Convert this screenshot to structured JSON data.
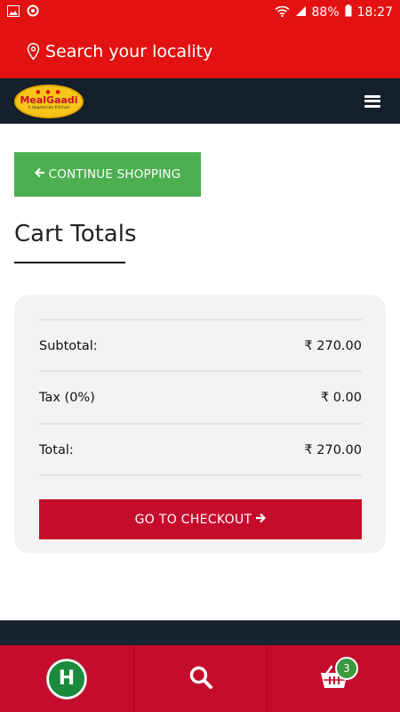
{
  "status_bar": {
    "battery": "88%",
    "time": "18:27",
    "icons": [
      "gallery-icon",
      "sync-icon",
      "wifi-icon",
      "signal-icon",
      "battery-icon"
    ]
  },
  "locality": {
    "label": "Search your locality",
    "icon": "location-pin-icon"
  },
  "navbar": {
    "logo_name": "MealGaadi",
    "logo_tagline": "A Vegetarian Kitchen",
    "menu_icon": "hamburger-icon"
  },
  "content": {
    "continue_label": "CONTINUE SHOPPING",
    "cart_title": "Cart Totals",
    "totals": [
      {
        "label": "Subtotal:",
        "value": "₹ 270.00"
      },
      {
        "label": "Tax (0%)",
        "value": "₹ 0.00"
      },
      {
        "label": "Total:",
        "value": "₹ 270.00"
      }
    ],
    "checkout_label": "GO TO CHECKOUT"
  },
  "bottom_nav": {
    "home_letter": "H",
    "cart_count": "3",
    "icons": [
      "home-logo-icon",
      "search-icon",
      "cart-icon"
    ]
  },
  "colors": {
    "header_red": "#e21212",
    "navbar_dark": "#14202b",
    "continue_green": "#4caf50",
    "checkout_red": "#c60c2c",
    "card_bg": "#f3f3f3"
  }
}
